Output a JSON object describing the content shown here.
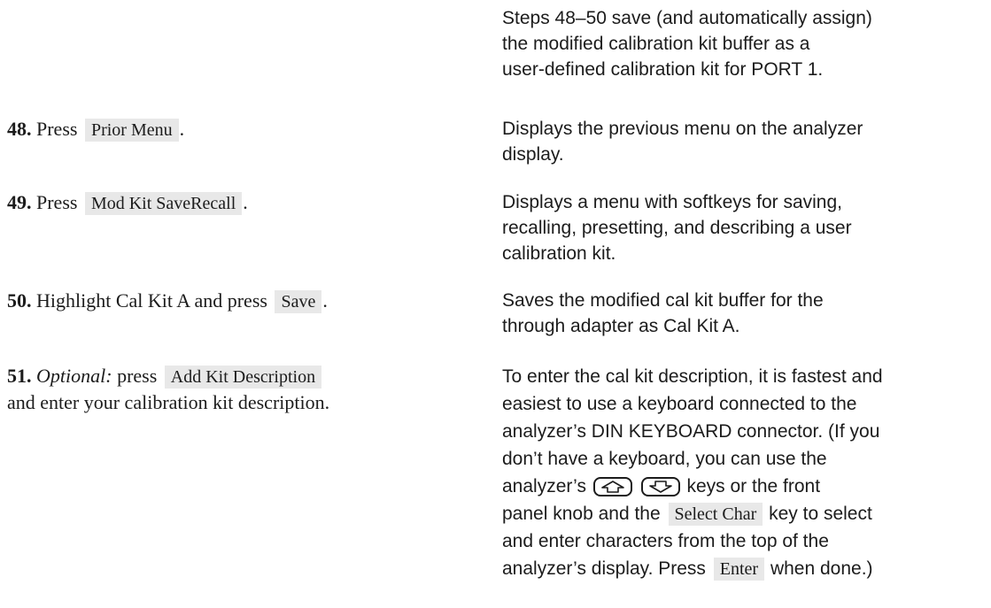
{
  "intro": {
    "line1": "Steps 48–50 save (and automatically assign)",
    "line2": "the modified calibration kit buffer as a",
    "line3": "user-defined calibration kit for PORT 1."
  },
  "steps": [
    {
      "number": "48.",
      "text": "Press",
      "key": "Prior Menu",
      "after": ".",
      "desc": [
        "Displays the previous menu on the analyzer",
        "display."
      ]
    },
    {
      "number": "49.",
      "text": "Press",
      "key": "Mod Kit SaveRecall",
      "after": ".",
      "desc": [
        "Displays a menu with softkeys for saving,",
        "recalling, presetting, and describing a user",
        "calibration kit."
      ]
    },
    {
      "number": "50.",
      "text": "Highlight Cal Kit A and press",
      "key": "Save",
      "after": ".",
      "desc": [
        "Saves the modified cal kit buffer for the",
        "through adapter as Cal Kit A."
      ]
    },
    {
      "number": "51.",
      "optional": "Optional:",
      "text": "press",
      "key": "Add Kit Description",
      "line2": "and enter your calibration kit description.",
      "desc": {
        "l1": "To enter the cal kit description, it is fastest and",
        "l2": "easiest to use a keyboard connected to the",
        "l3": "analyzer’s DIN KEYBOARD connector. (If you",
        "l4": "don’t have a keyboard, you can use the",
        "l5a": "analyzer’s",
        "l5b": "keys or the front",
        "l6a": "panel knob and the",
        "l6key": "Select Char",
        "l6b": "key to select",
        "l7": "and enter characters from the top of the",
        "l8a": "analyzer’s display. Press",
        "l8key": "Enter",
        "l8b": "when done.)"
      },
      "icons": [
        "up-arrow-key-icon",
        "down-arrow-key-icon"
      ]
    }
  ]
}
